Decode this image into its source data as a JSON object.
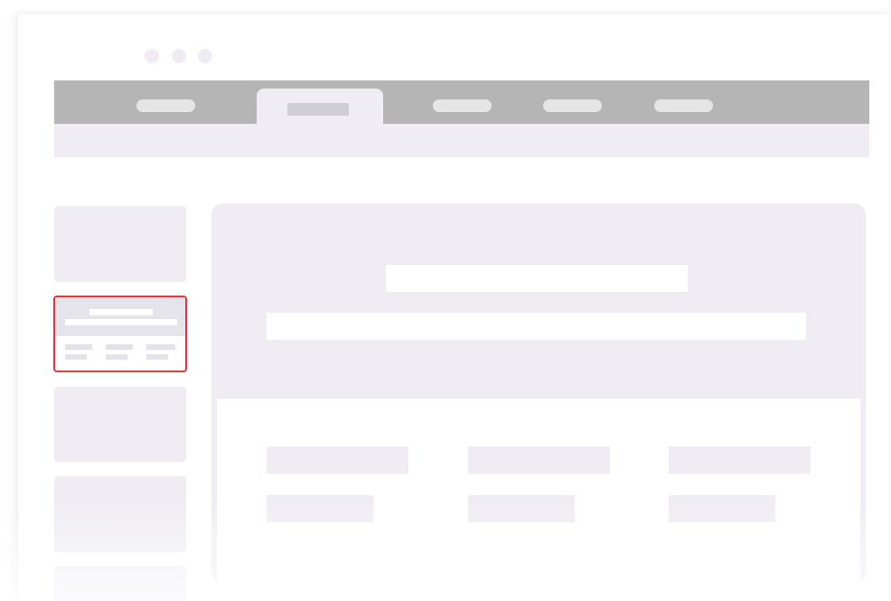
{
  "window": {
    "controls": [
      "close-dot",
      "minimize-dot",
      "maximize-dot"
    ]
  },
  "tabs": [
    {
      "label": "",
      "active": false
    },
    {
      "label": "",
      "active": true
    },
    {
      "label": "",
      "active": false
    },
    {
      "label": "",
      "active": false
    },
    {
      "label": "",
      "active": false
    }
  ],
  "sidebar": {
    "cards": 5,
    "selected_index": 1
  },
  "colors": {
    "tabbar": "#b5b5b5",
    "placeholder": "#efedf3",
    "selection": "#e8353b",
    "background": "#ffffff"
  }
}
